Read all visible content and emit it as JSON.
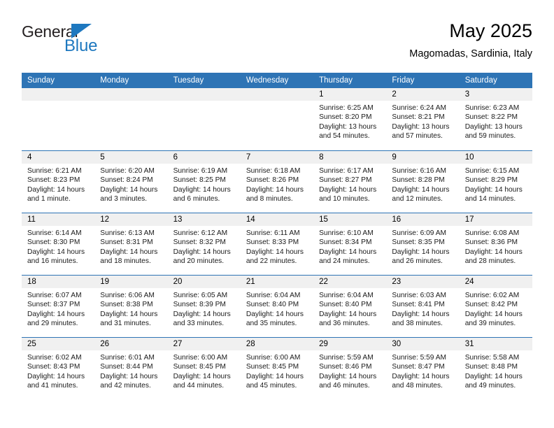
{
  "brand": {
    "name_top": "General",
    "name_bottom": "Blue",
    "accent_color": "#1e78bf"
  },
  "header": {
    "title": "May 2025",
    "location": "Magomadas, Sardinia, Italy"
  },
  "theme": {
    "header_blue": "#2e74b5",
    "day_band_gray": "#f0f0f0"
  },
  "weekdays": [
    "Sunday",
    "Monday",
    "Tuesday",
    "Wednesday",
    "Thursday",
    "Friday",
    "Saturday"
  ],
  "weeks": [
    [
      {
        "day": "",
        "sunrise": "",
        "sunset": "",
        "daylight": ""
      },
      {
        "day": "",
        "sunrise": "",
        "sunset": "",
        "daylight": ""
      },
      {
        "day": "",
        "sunrise": "",
        "sunset": "",
        "daylight": ""
      },
      {
        "day": "",
        "sunrise": "",
        "sunset": "",
        "daylight": ""
      },
      {
        "day": "1",
        "sunrise": "Sunrise: 6:25 AM",
        "sunset": "Sunset: 8:20 PM",
        "daylight": "Daylight: 13 hours and 54 minutes."
      },
      {
        "day": "2",
        "sunrise": "Sunrise: 6:24 AM",
        "sunset": "Sunset: 8:21 PM",
        "daylight": "Daylight: 13 hours and 57 minutes."
      },
      {
        "day": "3",
        "sunrise": "Sunrise: 6:23 AM",
        "sunset": "Sunset: 8:22 PM",
        "daylight": "Daylight: 13 hours and 59 minutes."
      }
    ],
    [
      {
        "day": "4",
        "sunrise": "Sunrise: 6:21 AM",
        "sunset": "Sunset: 8:23 PM",
        "daylight": "Daylight: 14 hours and 1 minute."
      },
      {
        "day": "5",
        "sunrise": "Sunrise: 6:20 AM",
        "sunset": "Sunset: 8:24 PM",
        "daylight": "Daylight: 14 hours and 3 minutes."
      },
      {
        "day": "6",
        "sunrise": "Sunrise: 6:19 AM",
        "sunset": "Sunset: 8:25 PM",
        "daylight": "Daylight: 14 hours and 6 minutes."
      },
      {
        "day": "7",
        "sunrise": "Sunrise: 6:18 AM",
        "sunset": "Sunset: 8:26 PM",
        "daylight": "Daylight: 14 hours and 8 minutes."
      },
      {
        "day": "8",
        "sunrise": "Sunrise: 6:17 AM",
        "sunset": "Sunset: 8:27 PM",
        "daylight": "Daylight: 14 hours and 10 minutes."
      },
      {
        "day": "9",
        "sunrise": "Sunrise: 6:16 AM",
        "sunset": "Sunset: 8:28 PM",
        "daylight": "Daylight: 14 hours and 12 minutes."
      },
      {
        "day": "10",
        "sunrise": "Sunrise: 6:15 AM",
        "sunset": "Sunset: 8:29 PM",
        "daylight": "Daylight: 14 hours and 14 minutes."
      }
    ],
    [
      {
        "day": "11",
        "sunrise": "Sunrise: 6:14 AM",
        "sunset": "Sunset: 8:30 PM",
        "daylight": "Daylight: 14 hours and 16 minutes."
      },
      {
        "day": "12",
        "sunrise": "Sunrise: 6:13 AM",
        "sunset": "Sunset: 8:31 PM",
        "daylight": "Daylight: 14 hours and 18 minutes."
      },
      {
        "day": "13",
        "sunrise": "Sunrise: 6:12 AM",
        "sunset": "Sunset: 8:32 PM",
        "daylight": "Daylight: 14 hours and 20 minutes."
      },
      {
        "day": "14",
        "sunrise": "Sunrise: 6:11 AM",
        "sunset": "Sunset: 8:33 PM",
        "daylight": "Daylight: 14 hours and 22 minutes."
      },
      {
        "day": "15",
        "sunrise": "Sunrise: 6:10 AM",
        "sunset": "Sunset: 8:34 PM",
        "daylight": "Daylight: 14 hours and 24 minutes."
      },
      {
        "day": "16",
        "sunrise": "Sunrise: 6:09 AM",
        "sunset": "Sunset: 8:35 PM",
        "daylight": "Daylight: 14 hours and 26 minutes."
      },
      {
        "day": "17",
        "sunrise": "Sunrise: 6:08 AM",
        "sunset": "Sunset: 8:36 PM",
        "daylight": "Daylight: 14 hours and 28 minutes."
      }
    ],
    [
      {
        "day": "18",
        "sunrise": "Sunrise: 6:07 AM",
        "sunset": "Sunset: 8:37 PM",
        "daylight": "Daylight: 14 hours and 29 minutes."
      },
      {
        "day": "19",
        "sunrise": "Sunrise: 6:06 AM",
        "sunset": "Sunset: 8:38 PM",
        "daylight": "Daylight: 14 hours and 31 minutes."
      },
      {
        "day": "20",
        "sunrise": "Sunrise: 6:05 AM",
        "sunset": "Sunset: 8:39 PM",
        "daylight": "Daylight: 14 hours and 33 minutes."
      },
      {
        "day": "21",
        "sunrise": "Sunrise: 6:04 AM",
        "sunset": "Sunset: 8:40 PM",
        "daylight": "Daylight: 14 hours and 35 minutes."
      },
      {
        "day": "22",
        "sunrise": "Sunrise: 6:04 AM",
        "sunset": "Sunset: 8:40 PM",
        "daylight": "Daylight: 14 hours and 36 minutes."
      },
      {
        "day": "23",
        "sunrise": "Sunrise: 6:03 AM",
        "sunset": "Sunset: 8:41 PM",
        "daylight": "Daylight: 14 hours and 38 minutes."
      },
      {
        "day": "24",
        "sunrise": "Sunrise: 6:02 AM",
        "sunset": "Sunset: 8:42 PM",
        "daylight": "Daylight: 14 hours and 39 minutes."
      }
    ],
    [
      {
        "day": "25",
        "sunrise": "Sunrise: 6:02 AM",
        "sunset": "Sunset: 8:43 PM",
        "daylight": "Daylight: 14 hours and 41 minutes."
      },
      {
        "day": "26",
        "sunrise": "Sunrise: 6:01 AM",
        "sunset": "Sunset: 8:44 PM",
        "daylight": "Daylight: 14 hours and 42 minutes."
      },
      {
        "day": "27",
        "sunrise": "Sunrise: 6:00 AM",
        "sunset": "Sunset: 8:45 PM",
        "daylight": "Daylight: 14 hours and 44 minutes."
      },
      {
        "day": "28",
        "sunrise": "Sunrise: 6:00 AM",
        "sunset": "Sunset: 8:45 PM",
        "daylight": "Daylight: 14 hours and 45 minutes."
      },
      {
        "day": "29",
        "sunrise": "Sunrise: 5:59 AM",
        "sunset": "Sunset: 8:46 PM",
        "daylight": "Daylight: 14 hours and 46 minutes."
      },
      {
        "day": "30",
        "sunrise": "Sunrise: 5:59 AM",
        "sunset": "Sunset: 8:47 PM",
        "daylight": "Daylight: 14 hours and 48 minutes."
      },
      {
        "day": "31",
        "sunrise": "Sunrise: 5:58 AM",
        "sunset": "Sunset: 8:48 PM",
        "daylight": "Daylight: 14 hours and 49 minutes."
      }
    ]
  ]
}
